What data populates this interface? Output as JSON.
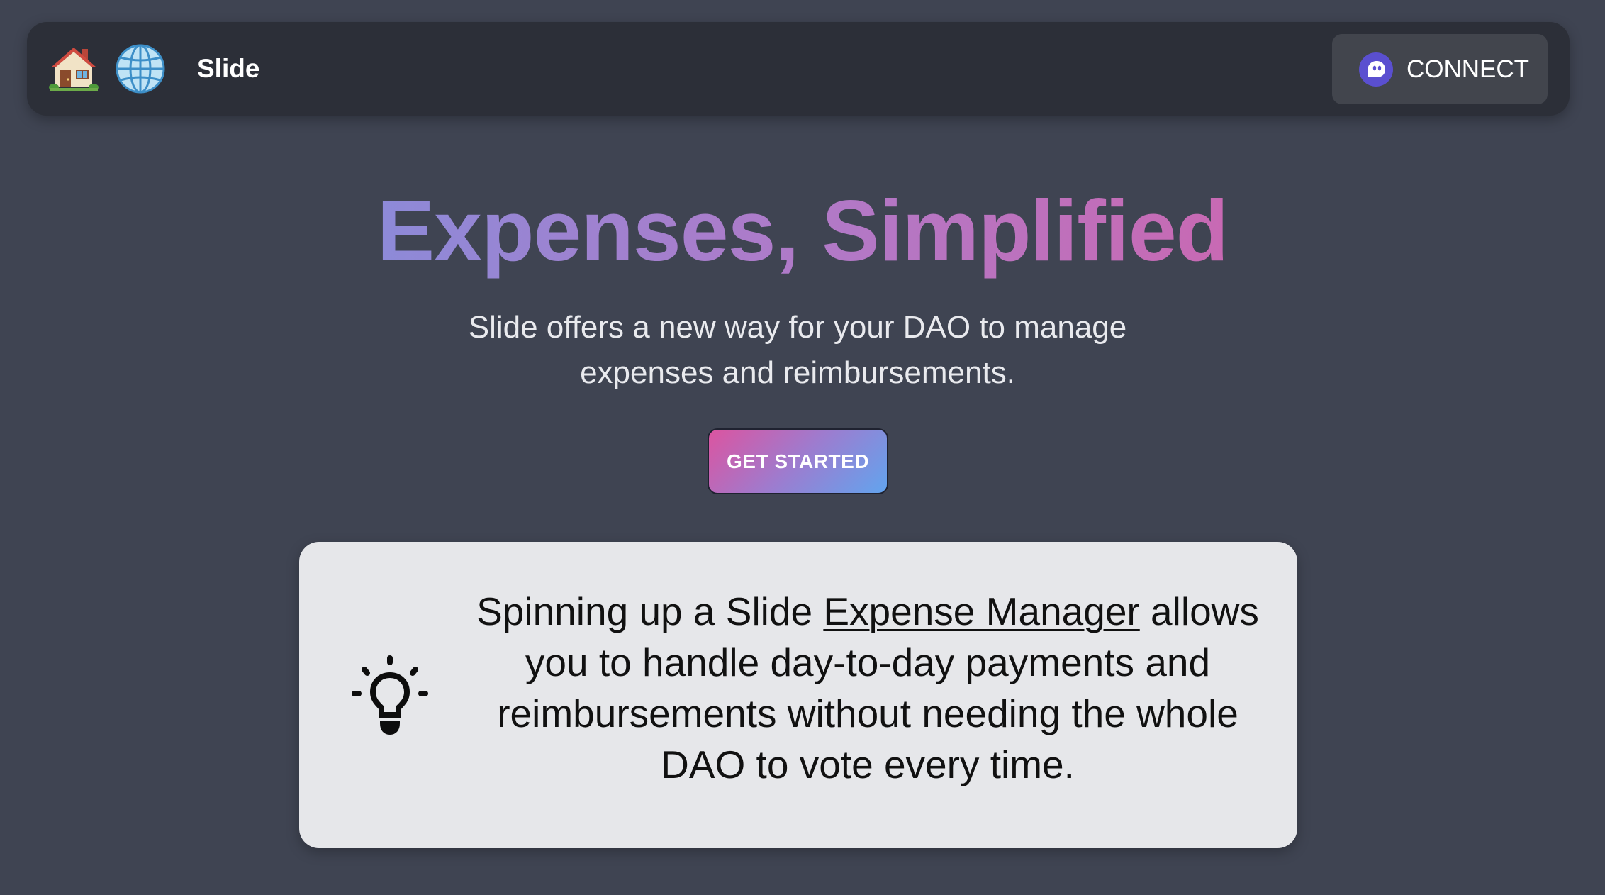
{
  "navbar": {
    "home_icon": "house-emoji-icon",
    "globe_icon": "globe-emoji-icon",
    "brand": "Slide",
    "connect_icon": "phantom-wallet-icon",
    "connect_label": "CONNECT"
  },
  "hero": {
    "title": "Expenses, Simplified",
    "subtitle": "Slide offers a new way for your DAO to manage expenses and reimbursements.",
    "cta_label": "GET STARTED"
  },
  "info_card": {
    "icon": "lightbulb-icon",
    "text_before_link": "Spinning up a Slide ",
    "link_text": "Expense Manager",
    "text_after_link": " allows you to handle day-to-day payments and reimbursements without needing the whole DAO to vote every time."
  },
  "colors": {
    "background": "#3f4452",
    "navbar": "#2c2f38",
    "connect_button": "#42454d",
    "card": "#e6e7ea",
    "title_gradient_start": "#8d8ad8",
    "title_gradient_end": "#c869b3",
    "cta_gradient_start": "#dc54a0",
    "cta_gradient_end": "#62a4ee"
  }
}
